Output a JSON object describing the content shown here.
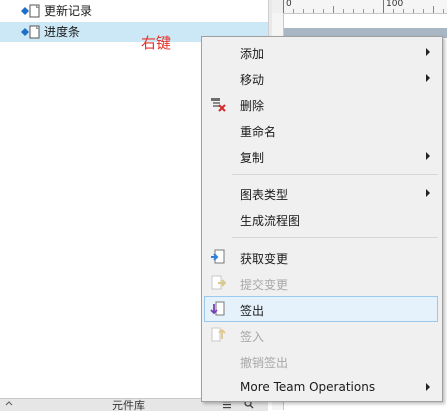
{
  "tree": {
    "items": [
      {
        "label": "更新记录",
        "selected": false
      },
      {
        "label": "进度条",
        "selected": true
      }
    ],
    "annotation": "右键"
  },
  "ruler": {
    "marks": [
      "0",
      "100"
    ]
  },
  "bottom_panel": {
    "title": "元件库"
  },
  "context_menu": {
    "items": [
      {
        "label": "添加",
        "submenu": true,
        "enabled": true
      },
      {
        "label": "移动",
        "submenu": true,
        "enabled": true
      },
      {
        "label": "删除",
        "submenu": false,
        "enabled": true,
        "icon": "delete-page-icon"
      },
      {
        "label": "重命名",
        "submenu": false,
        "enabled": true
      },
      {
        "label": "复制",
        "submenu": true,
        "enabled": true
      },
      {
        "label": "图表类型",
        "submenu": true,
        "enabled": true
      },
      {
        "label": "生成流程图",
        "submenu": false,
        "enabled": true
      },
      {
        "label": "获取变更",
        "submenu": false,
        "enabled": true,
        "icon": "get-changes-icon"
      },
      {
        "label": "提交变更",
        "submenu": false,
        "enabled": false,
        "icon": "commit-changes-icon"
      },
      {
        "label": "签出",
        "submenu": false,
        "enabled": true,
        "icon": "check-out-icon",
        "hover": true
      },
      {
        "label": "签入",
        "submenu": false,
        "enabled": false,
        "icon": "check-in-icon"
      },
      {
        "label": "撤销签出",
        "submenu": false,
        "enabled": false
      },
      {
        "label": "More Team Operations",
        "submenu": true,
        "enabled": true
      }
    ]
  },
  "colors": {
    "selection": "#cce8f6",
    "hover_fill": "#e5f1fb",
    "hover_border": "#99c9ef",
    "annotation": "#e8322c",
    "page_icon_blue": "#1e6fc8"
  }
}
